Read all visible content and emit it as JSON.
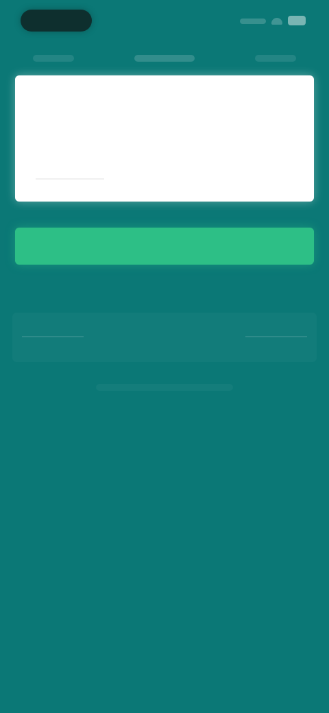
{
  "status_bar": {
    "time_pill": "",
    "icons": [
      "signal-icon",
      "wifi-icon",
      "battery-icon"
    ]
  },
  "input": {
    "value": "",
    "placeholder": ""
  },
  "primary_button": {
    "label": ""
  },
  "section": {
    "label": ""
  },
  "colors": {
    "background": "#0b7876",
    "card": "#ffffff",
    "accent": "#2dbf86",
    "status_pill": "#0e2f2e"
  }
}
